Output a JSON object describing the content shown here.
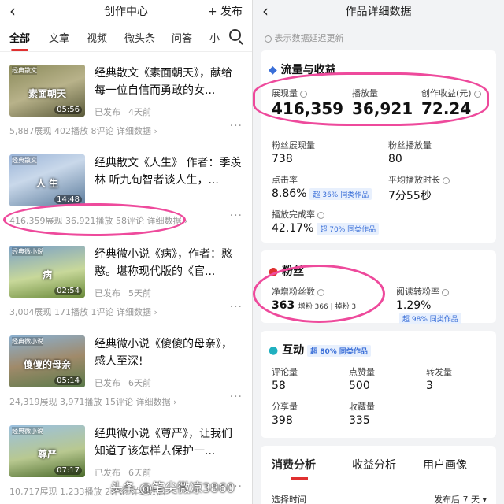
{
  "left": {
    "title": "创作中心",
    "publish_label": "+ 发布",
    "tabs": [
      "全部",
      "文章",
      "视频",
      "微头条",
      "问答",
      "小"
    ],
    "items": [
      {
        "category": "经典散文",
        "thumb_text": "素面朝天",
        "duration": "05:56",
        "title": "经典散文《素面朝天》，献给每一位自信而勇敢的女...",
        "status": "已发布",
        "time": "4天前",
        "stats": "5,887展现  402播放  8评论  详细数据 ›"
      },
      {
        "category": "经典散文",
        "thumb_text": "人 生",
        "duration": "14:48",
        "title": "经典散文《人生》 作者：季羡林 听九旬智者谈人生，...",
        "status": "",
        "time": "",
        "stats": "416,359展现  36,921播放  58评论  详细数据 ›"
      },
      {
        "category": "经典微小说",
        "thumb_text": "病",
        "duration": "02:54",
        "title": "经典微小说《病》，作者：憨憨。堪称现代版的《官...",
        "status": "已发布",
        "time": "5天前",
        "stats": "3,004展现  171播放  1评论  详细数据 ›"
      },
      {
        "category": "经典微小说",
        "thumb_text": "傻傻的母亲",
        "duration": "05:14",
        "title": "经典微小说《傻傻的母亲》，感人至深!",
        "status": "已发布",
        "time": "6天前",
        "stats": "24,319展现  3,971播放  15评论  详细数据 ›"
      },
      {
        "category": "经典微小说",
        "thumb_text": "尊严",
        "duration": "07:17",
        "title": "经典微小说《尊严》，让我们知道了该怎样去保护一...",
        "status": "已发布",
        "time": "6天前",
        "stats": "10,717展现  1,233播放  2评论  详细数据 ›"
      }
    ]
  },
  "right": {
    "title": "作品详细数据",
    "note": "表示数据延迟更新",
    "flow": {
      "section_title": "流量与收益",
      "impressions_label": "展现量",
      "impressions": "416,359",
      "plays_label": "播放量",
      "plays": "36,921",
      "income_label": "创作收益(元)",
      "income": "72.24",
      "fan_impr_label": "粉丝展现量",
      "fan_impr": "738",
      "fan_plays_label": "粉丝播放量",
      "fan_plays": "80",
      "ctr_label": "点击率",
      "ctr": "8.86%",
      "ctr_badge": "超 36% 同类作品",
      "avg_time_label": "平均播放时长",
      "avg_time": "7分55秒",
      "completion_label": "播放完成率",
      "completion": "42.17%",
      "completion_badge": "超 70% 同类作品"
    },
    "fans": {
      "section_title": "粉丝",
      "net_label": "净增粉丝数",
      "net": "363",
      "net_detail": "增粉 366 | 掉粉 3",
      "read_conv_label": "阅读转粉率",
      "read_conv": "1.29%",
      "read_conv_badge": "超 98% 同类作品"
    },
    "interact": {
      "section_title": "互动",
      "badge": "超 80% 同类作品",
      "comments_label": "评论量",
      "comments": "58",
      "likes_label": "点赞量",
      "likes": "500",
      "forwards_label": "转发量",
      "forwards": "3",
      "shares_label": "分享量",
      "shares": "398",
      "favs_label": "收藏量",
      "favs": "335"
    },
    "bottom_tabs": [
      "消费分析",
      "收益分析",
      "用户画像"
    ],
    "select_time_label": "选择时间",
    "select_time_value": "发布后 7 天 ▾"
  },
  "watermark": "头条 @笔尖微凉3860",
  "colors": {
    "highlight": "#ee4a9c",
    "accent": "#e03030",
    "badge": "#3a6fd8"
  }
}
